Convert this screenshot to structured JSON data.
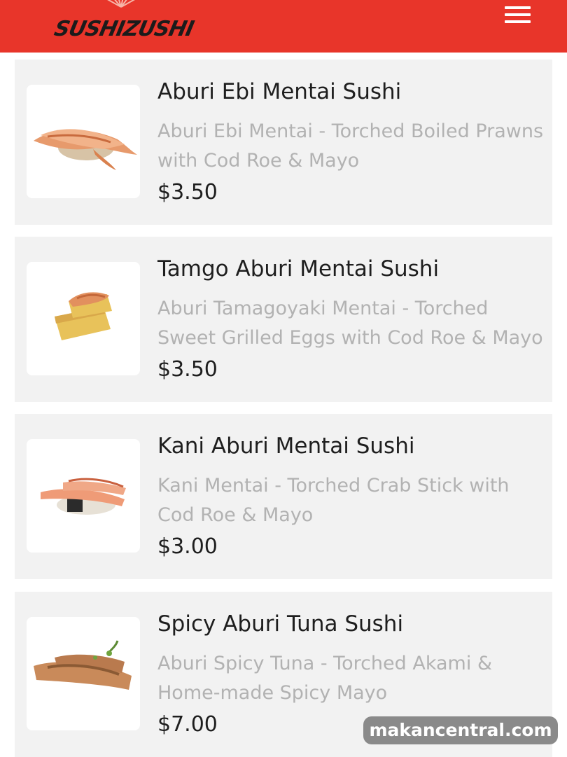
{
  "header": {
    "logo_text": "SUSHIZUSHI",
    "brand_color": "#e8352a",
    "menu_icon": "hamburger-menu-icon"
  },
  "menu_items": [
    {
      "title": "Aburi Ebi Mentai Sushi",
      "description": "Aburi Ebi Mentai - Torched Boiled Prawns with Cod Roe & Mayo",
      "price": "$3.50",
      "image_icon": "prawn-sushi-image"
    },
    {
      "title": "Tamgo Aburi Mentai Sushi",
      "description": "Aburi Tamagoyaki Mentai - Torched Sweet Grilled Eggs with Cod Roe & Mayo",
      "price": "$3.50",
      "image_icon": "egg-sushi-image"
    },
    {
      "title": "Kani Aburi Mentai Sushi",
      "description": "Kani Mentai - Torched Crab Stick with Cod Roe & Mayo",
      "price": "$3.00",
      "image_icon": "crab-stick-sushi-image"
    },
    {
      "title": "Spicy Aburi Tuna Sushi",
      "description": "Aburi Spicy Tuna - Torched Akami & Home-made Spicy Mayo",
      "price": "$7.00",
      "image_icon": "tuna-sushi-image"
    }
  ],
  "watermark": "makancentral.com"
}
